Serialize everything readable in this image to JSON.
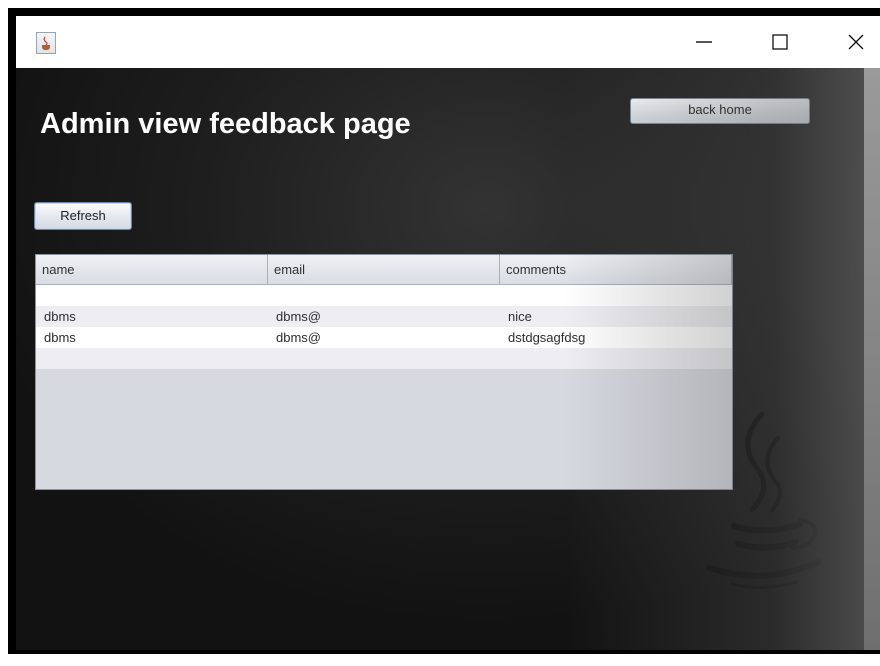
{
  "window": {
    "title": "",
    "icon": "java-cup-icon",
    "controls": [
      "minimize-icon",
      "maximize-icon",
      "close-icon"
    ]
  },
  "page": {
    "title": "Admin view feedback page",
    "back_home_label": "back home",
    "refresh_label": "Refresh"
  },
  "table": {
    "columns": [
      "name",
      "email",
      "comments"
    ],
    "rows": [
      [
        "",
        "",
        ""
      ],
      [
        "dbms",
        "dbms@",
        "nice"
      ],
      [
        "dbms",
        "dbms@",
        "dstdgsagfdsg"
      ],
      [
        "",
        "",
        ""
      ]
    ]
  },
  "decor": {
    "logo": "java-logo"
  }
}
